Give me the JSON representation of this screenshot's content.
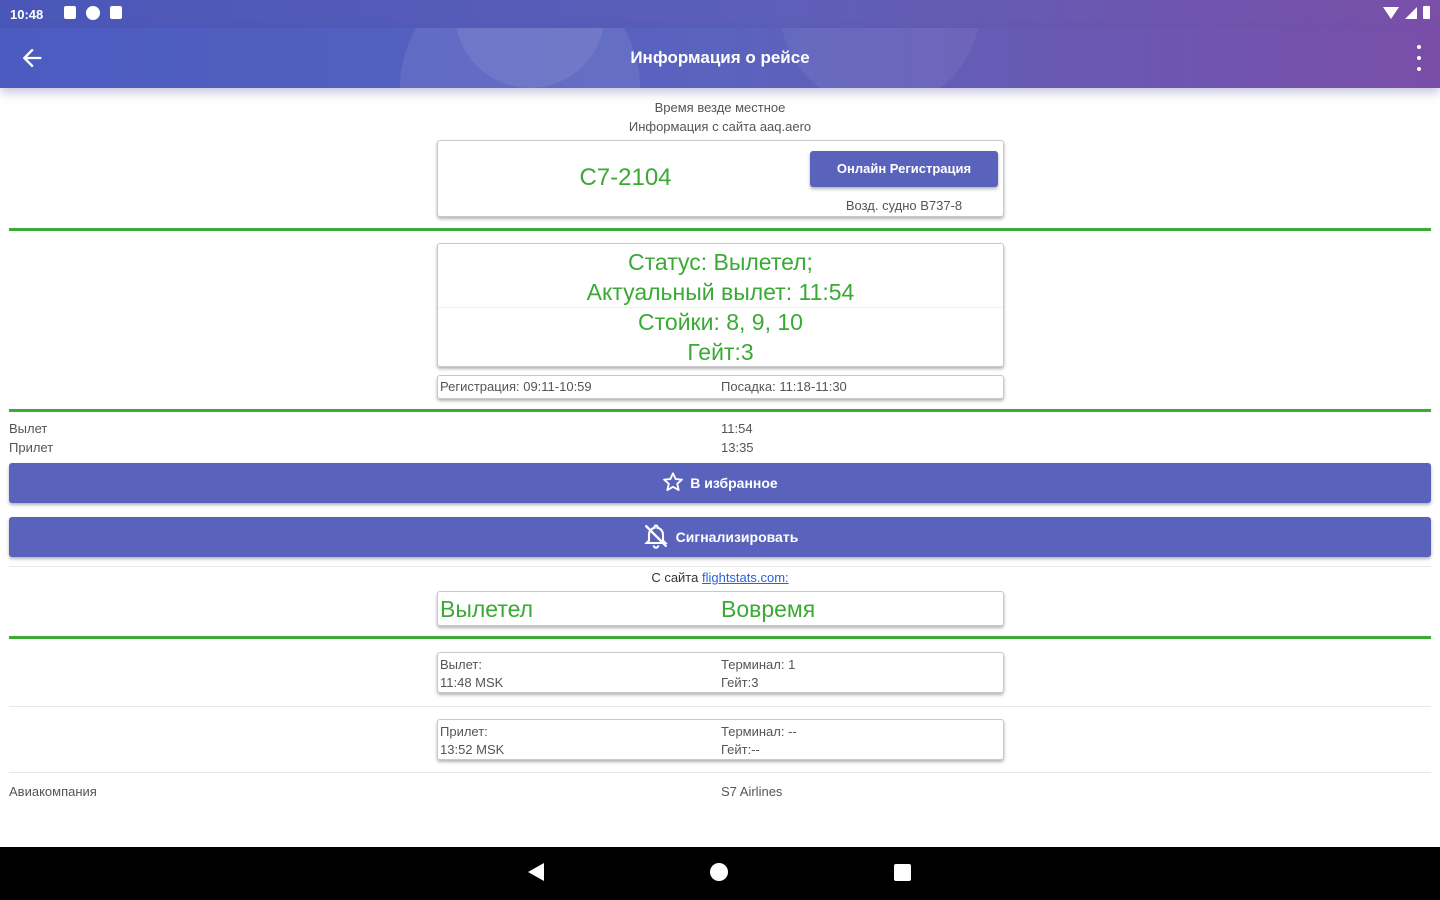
{
  "status_bar": {
    "time": "10:48"
  },
  "app_bar": {
    "title": "Информация о рейсе"
  },
  "notes": {
    "local_time": "Время везде местное",
    "source": "Информация с сайта aaq.aero"
  },
  "flight": {
    "number": "С7-2104",
    "online_checkin_label": "Онлайн Регистрация",
    "aircraft": "Возд. судно B737-8"
  },
  "status_card": {
    "line1": "Статус: Вылетел;",
    "line2": "Актуальный вылет: 11:54",
    "line3": "Стойки: 8, 9, 10",
    "line4": "Гейт:3"
  },
  "times_row": {
    "registration": "Регистрация: 09:11-10:59",
    "boarding": "Посадка: 11:18-11:30"
  },
  "schedule": {
    "departure_label": "Вылет",
    "departure_value": "11:54",
    "arrival_label": "Прилет",
    "arrival_value": "13:35"
  },
  "buttons": {
    "favorite": "В избранное",
    "notify": "Сигнализировать"
  },
  "flightstats": {
    "prefix": "С сайта ",
    "link": "flightstats.com:",
    "status": "Вылетел",
    "punctuality": "Вовремя"
  },
  "departure_card": {
    "label": "Вылет:",
    "time": "11:48 MSK",
    "terminal": "Терминал: 1",
    "gate": "Гейт:3"
  },
  "arrival_card": {
    "label": "Прилет:",
    "time": "13:52 MSK",
    "terminal": "Терминал: --",
    "gate": "Гейт:--"
  },
  "airline": {
    "label": "Авиакомпания",
    "value": "S7 Airlines"
  },
  "colors": {
    "accent": "#5a63bc",
    "green": "#3aaa35",
    "link": "#2a62d8"
  },
  "icons": [
    "back-arrow-icon",
    "more-vert-icon",
    "star-icon",
    "bell-off-icon",
    "nav-back-icon",
    "nav-home-icon",
    "nav-recents-icon"
  ]
}
